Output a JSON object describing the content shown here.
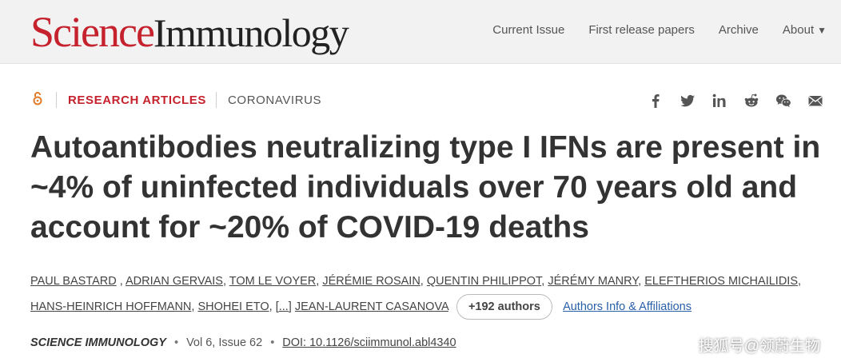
{
  "header": {
    "logo_science": "Science",
    "logo_journal": "Immunology",
    "nav": [
      "Current Issue",
      "First release papers",
      "Archive",
      "About"
    ]
  },
  "article": {
    "section": "RESEARCH ARTICLES",
    "topic": "CORONAVIRUS",
    "title": "Autoantibodies neutralizing type I IFNs are present in ~4% of uninfected individuals over 70 years old and account for ~20% of COVID-19 deaths",
    "authors": [
      "PAUL BASTARD",
      "ADRIAN GERVAIS",
      "TOM LE VOYER",
      "JÉRÉMIE ROSAIN",
      "QUENTIN PHILIPPOT",
      "JÉRÉMY MANRY",
      "ELEFTHERIOS MICHAILIDIS",
      "HANS-HEINRICH HOFFMANN",
      "SHOHEI ETO"
    ],
    "ellipsis": "[...]",
    "last_author": "JEAN-LAURENT CASANOVA",
    "more_authors": "+192 authors",
    "affiliations_link": "Authors Info & Affiliations",
    "journal": "SCIENCE IMMUNOLOGY",
    "volume": "Vol 6, Issue 62",
    "doi": "DOI: 10.1126/sciimmunol.abl4340"
  },
  "share_icons": [
    "facebook-icon",
    "twitter-icon",
    "linkedin-icon",
    "reddit-icon",
    "wechat-icon",
    "email-icon"
  ],
  "watermark": "搜狐号@领蔚生物",
  "colors": {
    "brand_red": "#c5222e",
    "link_blue": "#2760a8",
    "open_access_orange": "#e07b2a"
  }
}
